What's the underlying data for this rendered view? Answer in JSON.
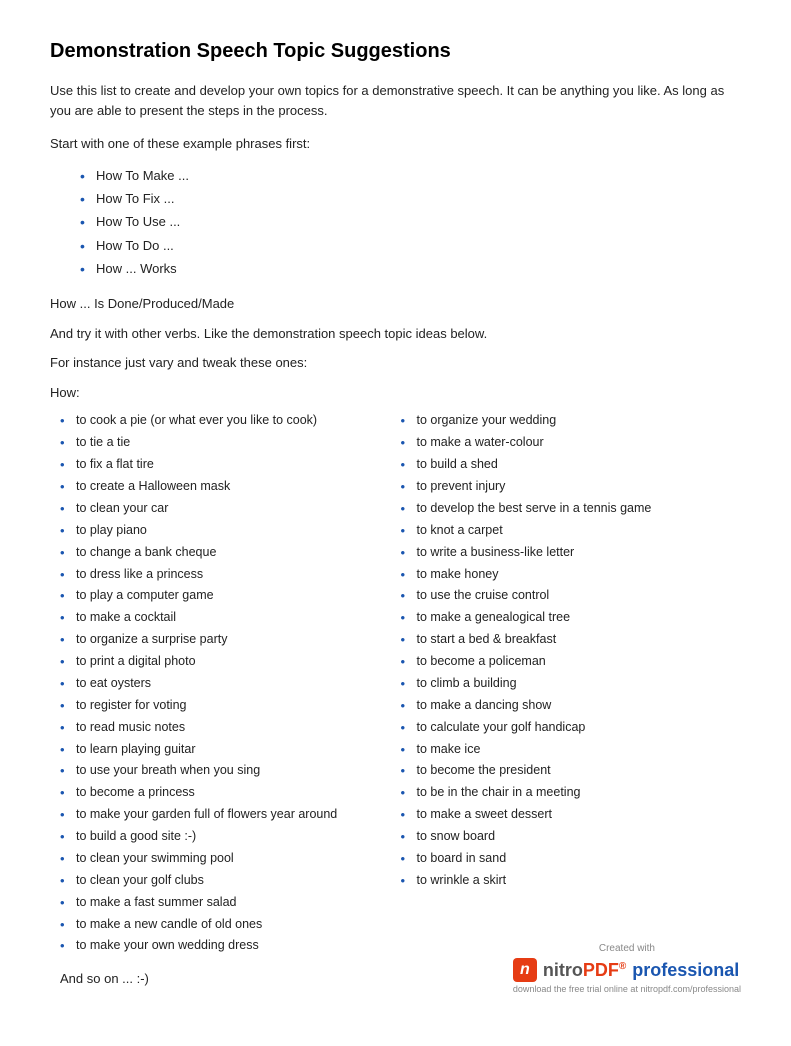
{
  "title": "Demonstration Speech Topic Suggestions",
  "intro": [
    "Use this list to create and develop your own topics for a demonstrative speech. It can be anything you like. As long as you are able to present the steps in the process.",
    "Start with one of these example phrases first:"
  ],
  "phrases": [
    "How To Make ...",
    "How To Fix ...",
    "How To Use ...",
    "How To Do ...",
    "How ... Works"
  ],
  "how_is_done": "How ... Is Done/Produced/Made",
  "try_other": "And try it with other verbs. Like the demonstration speech topic ideas below.",
  "for_instance": "For instance just vary and tweak these ones:",
  "how_label": "How:",
  "left_column": [
    "to cook a pie (or what ever you like to cook)",
    "to tie a tie",
    "to fix a flat tire",
    "to create a Halloween mask",
    "to clean your car",
    "to play piano",
    "to change a bank cheque",
    "to dress like a princess",
    "to play a computer game",
    "to make a cocktail",
    "to organize a surprise party",
    "to print a digital photo",
    "to eat oysters",
    "to register for voting",
    "to read music notes",
    "to learn playing guitar",
    "to use your breath when you sing",
    "to become a princess",
    "to make your garden full of flowers year around",
    "to build a good site :-)",
    "to clean your swimming pool",
    "to clean your golf clubs",
    "to make a fast summer salad",
    "to make a new candle of old ones",
    "to make your own wedding dress"
  ],
  "right_column": [
    "to organize your wedding",
    "to make a water-colour",
    "to build a shed",
    "to prevent injury",
    "to develop the best serve in a tennis game",
    "to knot a carpet",
    "to write a business-like letter",
    "to make honey",
    "to use the cruise control",
    "to make a genealogical tree",
    "to start a bed & breakfast",
    "to become a policeman",
    "to climb a building",
    "to make a dancing show",
    "to calculate your golf handicap",
    "to make ice",
    "to become the president",
    "to be in the chair in a meeting",
    "to make a sweet dessert",
    "to snow board",
    "to board in sand",
    "to wrinkle a skirt"
  ],
  "and_so_on": "And so on ... :-)",
  "footer": {
    "created_with": "Created with",
    "nitro_label": "nitro",
    "pdf_sup": "PDF",
    "reg": "®",
    "professional": "professional",
    "download": "download the free trial online at nitropdf.com/professional"
  }
}
